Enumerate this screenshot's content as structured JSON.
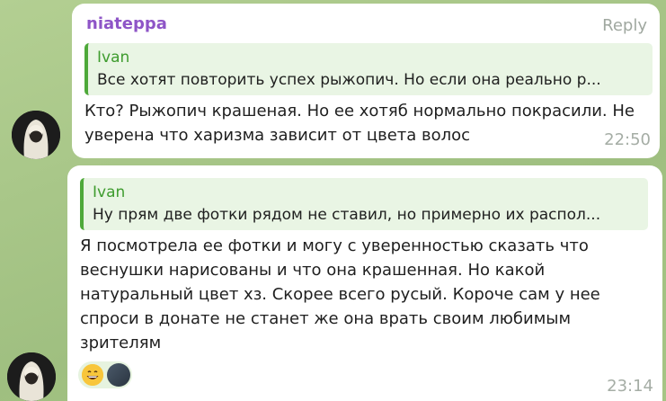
{
  "message1": {
    "sender": "niateppa",
    "reply_label": "Reply",
    "quote_author": "Ivan",
    "quote_text": "Все хотят повторить успех рыжопич. Но если она реально р...",
    "text": "Кто? Рыжопич крашеная. Но ее хотяб нормально покрасили. Не уверена что харизма зависит от цвета волос",
    "time": "22:50"
  },
  "message2": {
    "quote_author": "Ivan",
    "quote_text": "Ну прям две фотки рядом не ставил, но примерно их распол...",
    "text": "Я посмотрела ее фотки и могу с уверенностью сказать что веснушки нарисованы и что она крашенная. Но какой натуральный цвет хз. Скорее всего русый. Короче сам у нее спроси в донате не станет же она врать своим любимым зрителям",
    "reaction_emoji": "grinning-face-icon",
    "time": "23:14"
  },
  "colors": {
    "sender": "#8e55c7",
    "quote_accent": "#4ea93a",
    "quote_bg": "#e9f5e4",
    "chat_bg": "#a9c78a"
  }
}
